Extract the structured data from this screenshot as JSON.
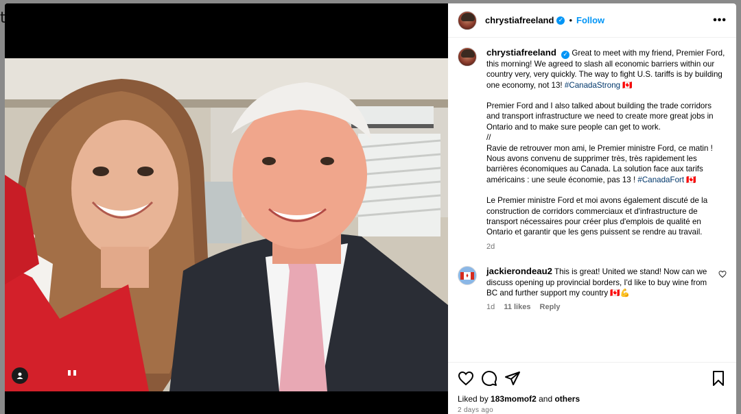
{
  "stray_text": "t",
  "post": {
    "header": {
      "username": "chrystiafreeland",
      "separator": "•",
      "follow_label": "Follow",
      "more_icon": "more-horizontal-icon"
    },
    "caption": {
      "username": "chrystiafreeland",
      "p1_text": "Great to meet with my friend, Premier Ford, this morning! We agreed to slash all economic barriers within our country very, very quickly. The way to fight U.S. tariffs is by building one economy, not 13! ",
      "p1_hashtag": "#CanadaStrong",
      "flag": "🇨🇦",
      "p2": "Premier Ford and I also talked about building the trade corridors and transport infrastructure we need to create more great jobs in Ontario and to make sure people can get to work.",
      "sep": "//",
      "p3_text": "Ravie de retrouver mon ami, le Premier ministre Ford, ce matin ! Nous avons convenu de supprimer très, très rapidement les barrières économiques au Canada. La solution face aux tarifs américains : une seule économie, pas 13 !",
      "p3_hashtag": "#CanadaFort",
      "p4": "Le Premier ministre Ford et moi avons également discuté de la construction de corridors commerciaux et d'infrastructure de transport nécessaires pour créer plus d'emplois de qualité en Ontario et garantir que les gens puissent se rendre au travail.",
      "age": "2d"
    },
    "comment": {
      "username": "jackierondeau2",
      "text": "This is great! United we stand! Now can we discuss opening up provincial borders, I'd like to buy wine from BC and further support my country 🇨🇦💪",
      "age": "1d",
      "likes": "11 likes",
      "reply_label": "Reply"
    },
    "likes": {
      "prefix": "Liked by",
      "user": "183momof2",
      "middle": "and",
      "others": "others"
    },
    "date": "2 days ago"
  },
  "icons": {
    "like": "heart-icon",
    "comment": "comment-icon",
    "share": "share-icon",
    "save": "bookmark-icon",
    "user_tag": "user-tag-icon"
  },
  "colors": {
    "link_blue": "#0095f6",
    "hashtag": "#00376b",
    "muted": "#737373"
  }
}
